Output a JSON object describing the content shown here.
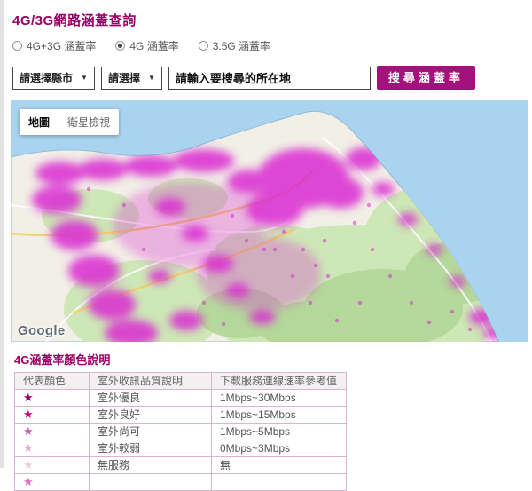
{
  "page": {
    "title": "4G/3G網路涵蓋查詢"
  },
  "coverage_options": {
    "radios": [
      {
        "label": "4G+3G 涵蓋率",
        "selected": false
      },
      {
        "label": "4G 涵蓋率",
        "selected": true
      },
      {
        "label": "3.5G 涵蓋率",
        "selected": false
      }
    ]
  },
  "search": {
    "city_select_label": "請選擇縣市",
    "district_select_label": "請選擇",
    "caret": "▼",
    "input_value": "請輸入要搜尋的所在地",
    "button_label": "搜尋涵蓋率"
  },
  "map": {
    "map_button_label": "地圖",
    "satellite_button_label": "衛星檢視",
    "logo": "Google"
  },
  "legend": {
    "title": "4G涵蓋率顏色說明",
    "star_glyph": "★",
    "headers": [
      "代表顏色",
      "室外收訊品質說明",
      "下載服務連線速率參考值"
    ],
    "rows": [
      {
        "quality": "室外優良",
        "speed": "1Mbps~30Mbps",
        "star_style": "color:#990066"
      },
      {
        "quality": "室外良好",
        "speed": "1Mbps~15Mbps",
        "star_style": "color:#c4007e"
      },
      {
        "quality": "室外尚可",
        "speed": "1Mbps~5Mbps",
        "star_style": "color:#c65fae"
      },
      {
        "quality": "室外較弱",
        "speed": "0Mbps~3Mbps",
        "star_style": "color:#e9a6d0"
      },
      {
        "quality": "無服務",
        "speed": "無",
        "star_style": "color:#e6d0dc"
      }
    ],
    "partial_row": {
      "star_style": "color:#e06db6"
    }
  },
  "colors": {
    "brand": "#990066",
    "button_bg": "#a4117c",
    "coverage_magenta": "#da2ad2",
    "map_water": "#a9d3ee",
    "map_land": "#f2efe6"
  }
}
